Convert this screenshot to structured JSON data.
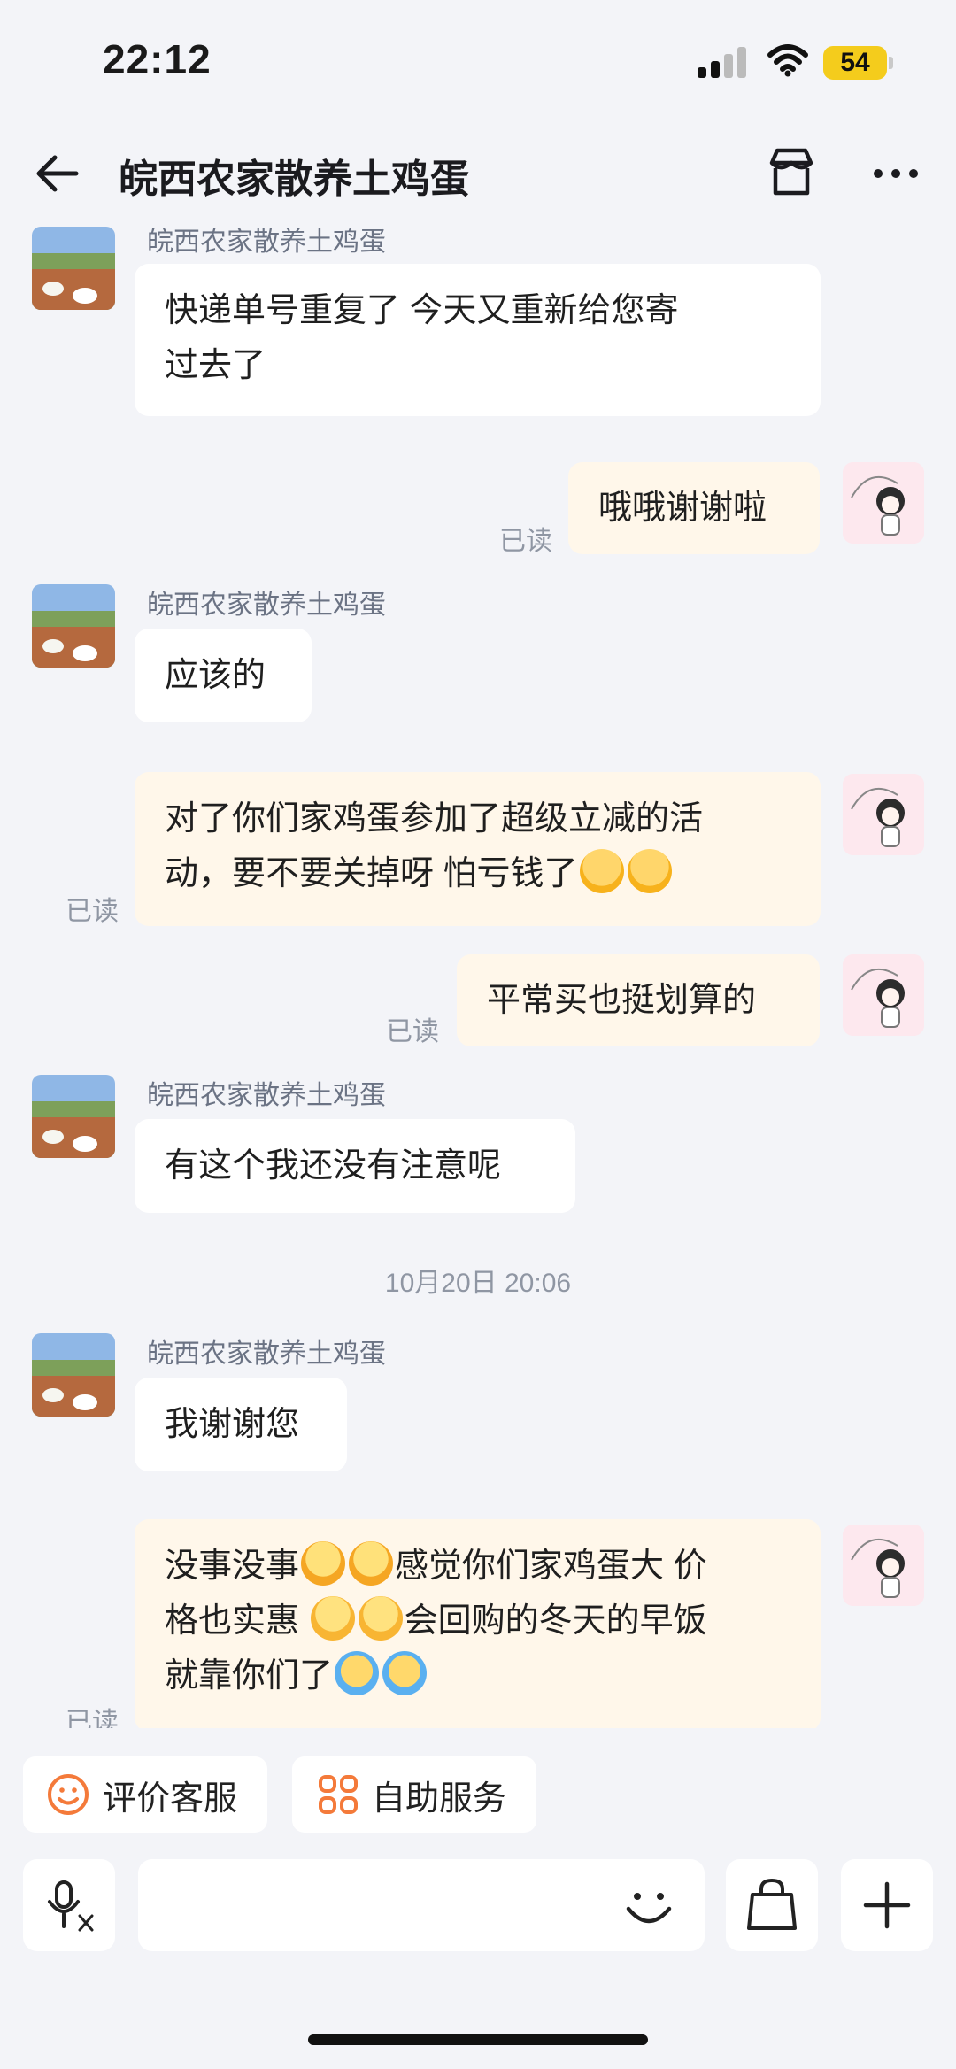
{
  "status_bar": {
    "time": "22:12",
    "battery": "54",
    "icons": [
      "signal-icon",
      "wifi-icon",
      "battery-icon"
    ]
  },
  "header": {
    "title": "皖西农家散养土鸡蛋",
    "icons": [
      "back-arrow-icon",
      "shop-icon",
      "more-icon"
    ]
  },
  "chat": {
    "shop_name": "皖西农家散养土鸡蛋",
    "read_label": "已读",
    "timestamp": "10月20日 20:06",
    "messages": [
      {
        "side": "in",
        "text": [
          "快递单号重复了  今天又重新给您寄",
          "过去了"
        ]
      },
      {
        "side": "out",
        "text": [
          "哦哦谢谢啦"
        ]
      },
      {
        "side": "in",
        "text": [
          "应该的"
        ]
      },
      {
        "side": "out",
        "text": [
          "对了你们家鸡蛋参加了超级立减的活",
          "动，要不要关掉呀 怕亏钱了"
        ],
        "emoji": [
          "angel-face-emoji",
          "angel-face-emoji"
        ]
      },
      {
        "side": "out",
        "text": [
          "平常买也挺划算的"
        ]
      },
      {
        "side": "in",
        "text": [
          "有这个我还没有注意呢"
        ]
      },
      {
        "side": "in",
        "text": [
          "我谢谢您"
        ]
      },
      {
        "side": "out",
        "text": [
          "没事没事",
          "感觉你们家鸡蛋大 价",
          "格也实惠 ",
          "会回购的冬天的早饭",
          "就靠你们了"
        ],
        "emoji": [
          "grinning-squint-emoji",
          "smirk-emoji",
          "laughing-tears-emoji"
        ]
      }
    ]
  },
  "quick_actions": [
    {
      "label": "评价客服",
      "icon": "smile-icon"
    },
    {
      "label": "自助服务",
      "icon": "grid-icon"
    }
  ],
  "input_bar": {
    "placeholder": "",
    "icons": [
      "voice-to-text-icon",
      "emoji-icon",
      "shopping-bag-icon",
      "plus-icon"
    ]
  },
  "colors": {
    "background": "#f3f4f8",
    "incoming_bubble": "#ffffff",
    "outgoing_bubble": "#fff7ea",
    "accent_orange": "#f47a3a",
    "battery": "#f4cc1c"
  }
}
